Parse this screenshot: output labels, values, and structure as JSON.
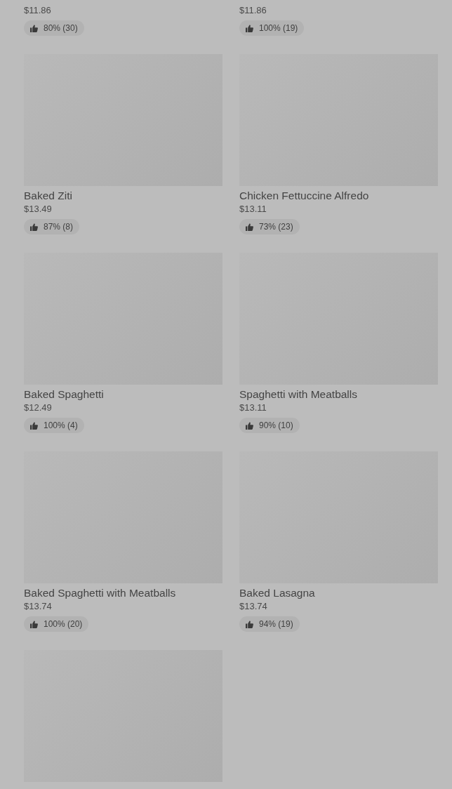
{
  "menu_items": [
    {
      "price": "$11.86",
      "rating": "80% (30)"
    },
    {
      "price": "$11.86",
      "rating": "100% (19)"
    },
    {
      "image": true,
      "name": "Baked Ziti",
      "price": "$13.49",
      "rating": "87% (8)"
    },
    {
      "image": true,
      "name": "Chicken Fettuccine Alfredo",
      "price": "$13.11",
      "rating": "73% (23)"
    },
    {
      "image": true,
      "name": "Baked Spaghetti",
      "price": "$12.49",
      "rating": "100% (4)"
    },
    {
      "image": true,
      "name": "Spaghetti with Meatballs",
      "price": "$13.11",
      "rating": "90% (10)"
    },
    {
      "image": true,
      "name": "Baked Spaghetti with Meatballs",
      "price": "$13.74",
      "rating": "100% (20)"
    },
    {
      "image": true,
      "name": "Baked Lasagna",
      "price": "$13.74",
      "rating": "94% (19)"
    },
    {
      "image": true
    }
  ]
}
